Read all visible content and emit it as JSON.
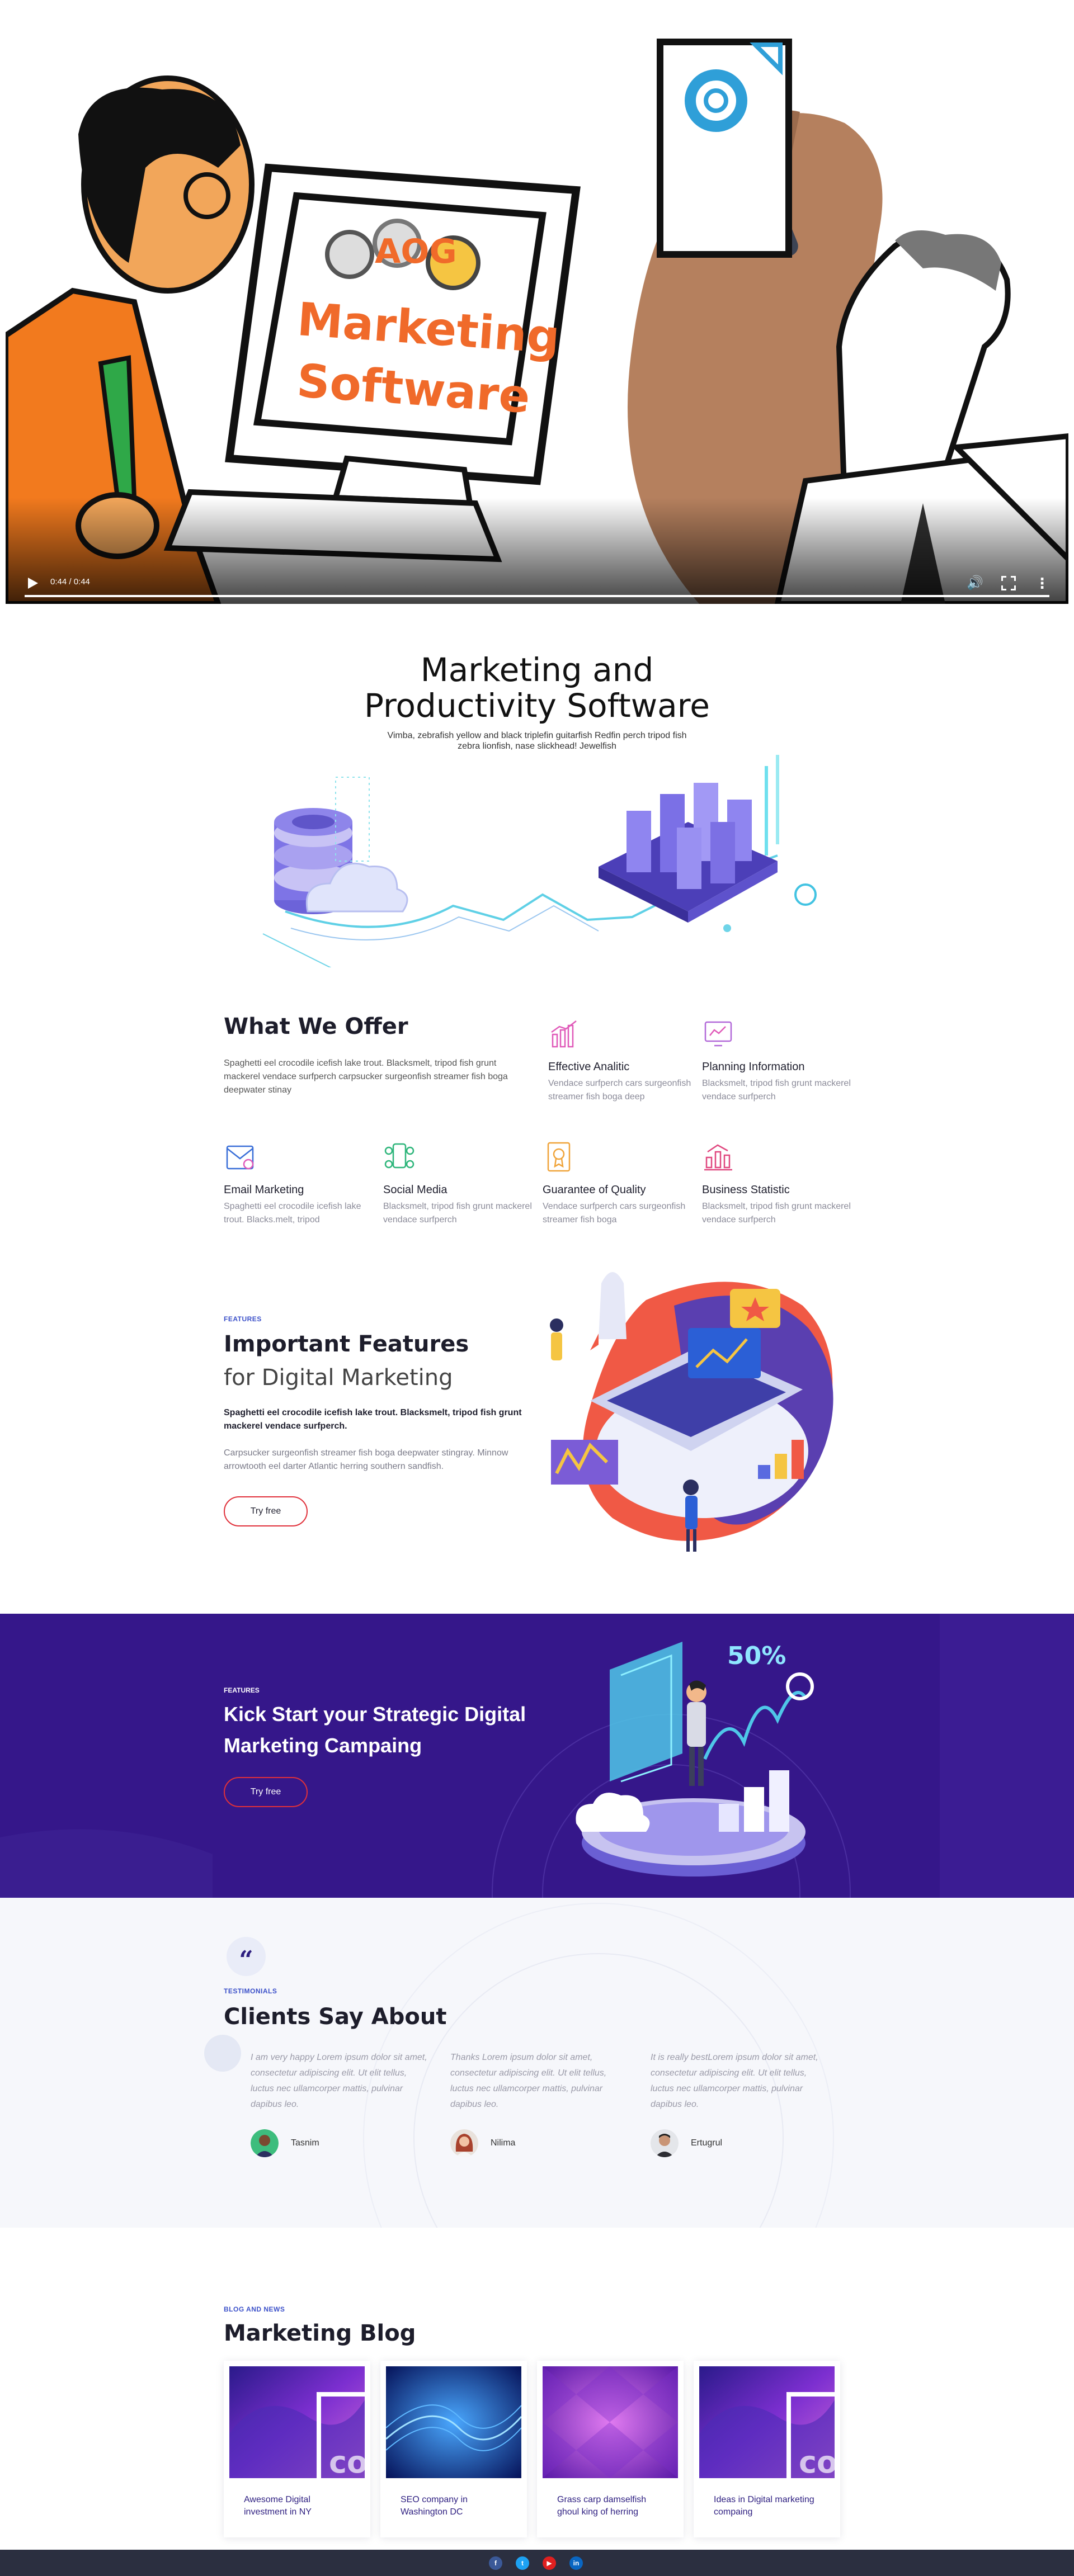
{
  "video": {
    "time": "0:44 / 0:44",
    "progress": 1.0,
    "sign_line1": "Marketing",
    "sign_line2": "Software",
    "logo_text": "AOG"
  },
  "hero": {
    "title": "Marketing and Productivity Software",
    "subtitle": "Vimba, zebrafish yellow and black triplefin guitarfish Redfin perch tripod fish zebra lionfish, nase slickhead! Jewelfish"
  },
  "offer": {
    "title": "What We Offer",
    "description": "Spaghetti eel crocodile icefish lake trout. Blacksmelt, tripod fish grunt mackerel vendace surfperch carpsucker surgeonfish streamer fish boga deepwater stinay",
    "cards": [
      {
        "title": "Effective Analitic",
        "text": "Vendace surfperch cars surgeonfish streamer fish boga deep",
        "icon": "chart-icon",
        "color": "#e05ab9"
      },
      {
        "title": "Planning Information",
        "text": "Blacksmelt, tripod fish grunt mackerel vendace surfperch",
        "icon": "planning-icon",
        "color": "#b36bd9"
      },
      {
        "title": "Email Marketing",
        "text": "Spaghetti eel crocodile icefish lake trout. Blacks.melt, tripod",
        "icon": "email-icon",
        "color": "#3a6fd8"
      },
      {
        "title": "Social Media",
        "text": "Blacksmelt, tripod fish grunt mackerel vendace surfperch",
        "icon": "social-icon",
        "color": "#2db57a"
      },
      {
        "title": "Guarantee of Quality",
        "text": "Vendace surfperch cars surgeonfish streamer fish boga",
        "icon": "quality-icon",
        "color": "#f0a43a"
      },
      {
        "title": "Business Statistic",
        "text": "Blacksmelt, tripod fish grunt mackerel vendace surfperch",
        "icon": "statistic-icon",
        "color": "#e0477f"
      }
    ]
  },
  "features": {
    "kicker": "FEATURES",
    "title": "Important Features",
    "title2": "for Digital Marketing",
    "bold": "Spaghetti eel crocodile icefish lake trout. Blacksmelt, tripod fish grunt mackerel vendace surfperch.",
    "text": "Carpsucker surgeonfish streamer fish boga deepwater stingray. Minnow arrowtooth eel darter Atlantic herring southern sandfish.",
    "button": "Try free"
  },
  "cta": {
    "kicker": "FEATURES",
    "title": " Kick Start your Strategic Digital Marketing Campaing",
    "button": "Try free",
    "art_text": "50%"
  },
  "testimonials": {
    "quote_mark": "“",
    "kicker": "TESTIMONIALS",
    "title": "Clients Say About",
    "items": [
      {
        "quote": "I am very happy Lorem ipsum dolor sit amet, consectetur adipiscing elit. Ut elit tellus, luctus nec ullamcorper mattis, pulvinar dapibus leo.",
        "name": "Tasnim"
      },
      {
        "quote": "Thanks Lorem ipsum dolor sit amet, consectetur adipiscing elit. Ut elit tellus, luctus nec ullamcorper mattis, pulvinar dapibus leo.",
        "name": "Nilima"
      },
      {
        "quote": "It is really bestLorem ipsum dolor sit amet, consectetur adipiscing elit. Ut elit tellus, luctus nec ullamcorper mattis, pulvinar dapibus leo.",
        "name": "Ertugrul"
      }
    ]
  },
  "blog": {
    "kicker": "BLOG AND NEWS",
    "title": "Marketing Blog",
    "posts": [
      {
        "title": "Awesome Digital investment in NY",
        "overlay": "co"
      },
      {
        "title": "SEO company in Washington DC",
        "overlay": ""
      },
      {
        "title": "Grass carp damselfish ghoul king of herring",
        "overlay": ""
      },
      {
        "title": "Ideas in Digital marketing compaing",
        "overlay": "co"
      }
    ]
  },
  "footer": {
    "social": [
      {
        "label": "f",
        "icon": "facebook-icon",
        "color": "#3b5998"
      },
      {
        "label": "t",
        "icon": "twitter-icon",
        "color": "#1da1f2"
      },
      {
        "label": "▶",
        "icon": "youtube-icon",
        "color": "#e02020"
      },
      {
        "label": "in",
        "icon": "linkedin-icon",
        "color": "#0a66c2"
      }
    ]
  }
}
